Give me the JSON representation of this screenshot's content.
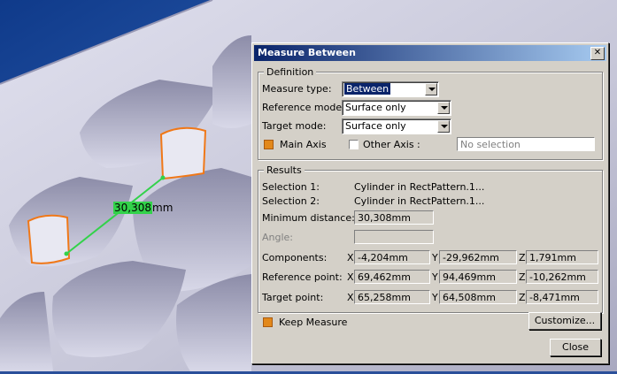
{
  "viewport": {
    "measure_value": "30,308",
    "measure_unit": "mm"
  },
  "dialog": {
    "title": "Measure Between",
    "close_glyph": "✕",
    "definition": {
      "legend": "Definition",
      "measure_type_label": "Measure type:",
      "measure_type_value": "Between",
      "reference_mode_label": "Reference mode:",
      "reference_mode_value": "Surface only",
      "target_mode_label": "Target mode:",
      "target_mode_value": "Surface only",
      "main_axis_label": "Main Axis",
      "main_axis_checked": true,
      "other_axis_label": "Other Axis :",
      "other_axis_checked": false,
      "other_axis_value": "No selection"
    },
    "results": {
      "legend": "Results",
      "selection1_label": "Selection 1:",
      "selection1_value": "Cylinder in RectPattern.1...",
      "selection2_label": "Selection 2:",
      "selection2_value": "Cylinder in RectPattern.1...",
      "min_distance_label": "Minimum distance:",
      "min_distance_value": "30,308mm",
      "angle_label": "Angle:",
      "angle_value": "",
      "components_label": "Components:",
      "components": {
        "x": "-4,204mm",
        "y": "-29,962mm",
        "z": "1,791mm"
      },
      "reference_point_label": "Reference point:",
      "reference_point": {
        "x": "69,462mm",
        "y": "94,469mm",
        "z": "-10,262mm"
      },
      "target_point_label": "Target point:",
      "target_point": {
        "x": "65,258mm",
        "y": "64,508mm",
        "z": "-8,471mm"
      },
      "axis_x": "X",
      "axis_y": "Y",
      "axis_z": "Z"
    },
    "keep_measure_label": "Keep Measure",
    "keep_measure_checked": true,
    "customize_label": "Customize...",
    "close_label": "Close"
  }
}
